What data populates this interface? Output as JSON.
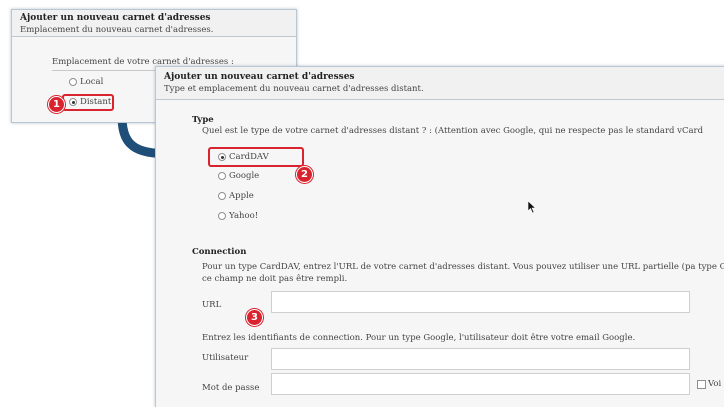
{
  "dialog1": {
    "title": "Ajouter un nouveau carnet d'adresses",
    "subtitle": "Emplacement du nouveau carnet d'adresses.",
    "location_label": "Emplacement de votre carnet d'adresses :",
    "options": [
      {
        "label": "Local",
        "selected": false
      },
      {
        "label": "Distant",
        "selected": true
      }
    ]
  },
  "dialog2": {
    "title": "Ajouter un nouveau carnet d'adresses",
    "subtitle": "Type et emplacement du nouveau carnet d'adresses distant.",
    "type_section": {
      "title": "Type",
      "question": "Quel est le type de votre carnet d'adresses distant ? : (Attention avec Google, qui ne respecte pas le standard vCard",
      "options": [
        {
          "label": "CardDAV",
          "selected": true
        },
        {
          "label": "Google",
          "selected": false
        },
        {
          "label": "Apple",
          "selected": false
        },
        {
          "label": "Yahoo!",
          "selected": false
        }
      ]
    },
    "connection_section": {
      "title": "Connection",
      "description": "Pour un type CardDAV, entrez l'URL de votre carnet d'adresses distant. Vous pouvez utiliser une URL partielle (pa type Google, ce champ ne doit pas être rempli.",
      "url_label": "URL",
      "url_value": "",
      "credentials_description": "Entrez les identifiants de connection. Pour un type Google, l'utilisateur doit être votre email Google.",
      "user_label": "Utilisateur",
      "user_value": "",
      "password_label": "Mot de passe",
      "password_value": "",
      "show_password_label": "Voi"
    }
  },
  "annotations": {
    "badge1": "1",
    "badge2": "2",
    "badge3": "3",
    "highlight_color": "#d9232e",
    "arrow_color": "#1f4e79"
  }
}
